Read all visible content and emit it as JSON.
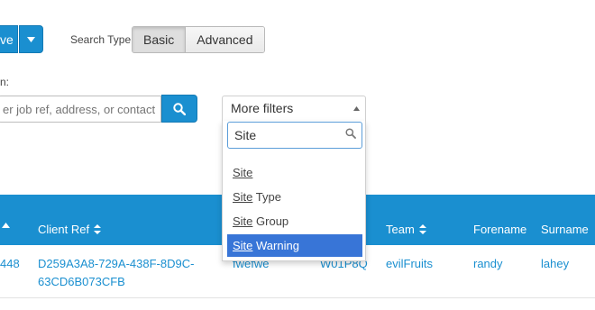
{
  "toolbar": {
    "main_button_label": "ve",
    "search_type_label": "Search Type:",
    "search_types": [
      "Basic",
      "Advanced"
    ],
    "active_search_type": "Basic"
  },
  "search": {
    "label": "n:",
    "placeholder": "er job ref, address, or contact"
  },
  "filters": {
    "header": "More filters",
    "query": "Site",
    "options": [
      {
        "match": "Site",
        "rest": ""
      },
      {
        "match": "Site",
        "rest": " Type"
      },
      {
        "match": "Site",
        "rest": " Group"
      },
      {
        "match": "Site",
        "rest": " Warning"
      }
    ],
    "highlighted_index": 3
  },
  "table": {
    "columns": [
      "",
      "Client Ref",
      "",
      "",
      "Team",
      "Forename",
      "Surname"
    ],
    "rows": [
      {
        "id": "448",
        "client_ref_line1": "D259A3A8-729A-438F-8D9C-",
        "client_ref_line2": "63CD6B073CFB",
        "col3": "fwefwe",
        "col4": "W01P8Q",
        "team": "evilFruits",
        "forename": "randy",
        "surname": "lahey"
      }
    ]
  },
  "colors": {
    "primary": "#1a8fd0",
    "highlight": "#3875d7"
  }
}
